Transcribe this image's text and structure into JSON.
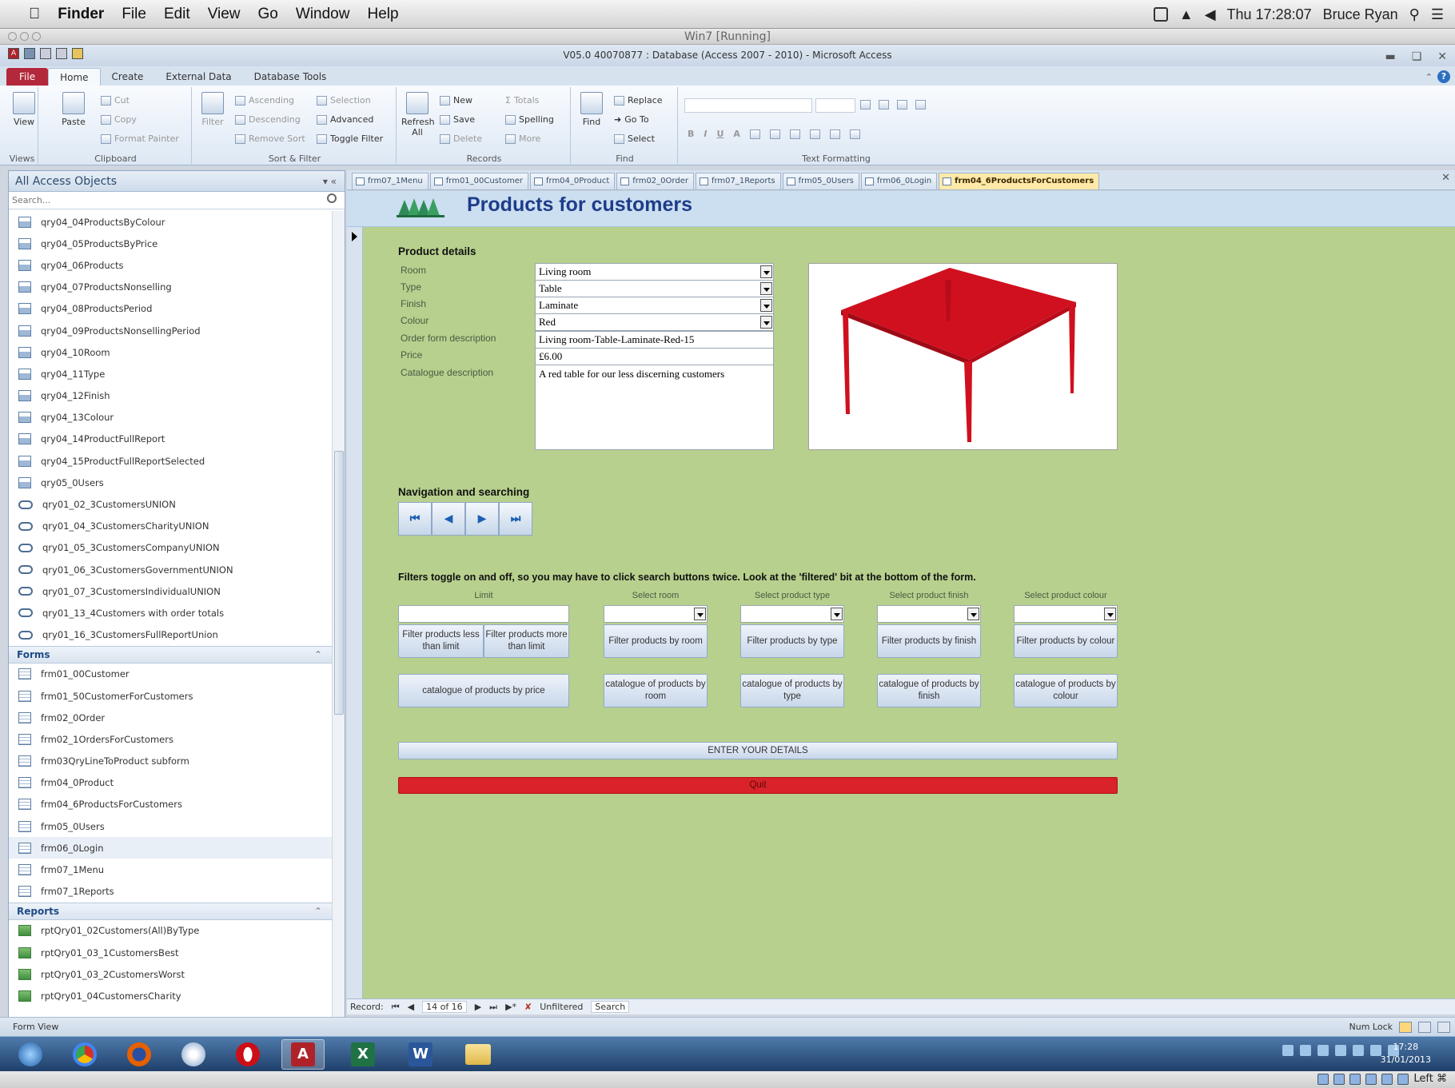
{
  "mac_menubar": {
    "items": [
      "Finder",
      "File",
      "Edit",
      "View",
      "Go",
      "Window",
      "Help"
    ],
    "clock": "Thu 17:28:07",
    "user": "Bruce Ryan"
  },
  "vm_title": "Win7 [Running]",
  "access_title": "V05.0 40070877 : Database (Access 2007 - 2010) - Microsoft Access",
  "ribbon_tabs": [
    "File",
    "Home",
    "Create",
    "External Data",
    "Database Tools"
  ],
  "ribbon": {
    "views": {
      "view": "View",
      "group": "Views"
    },
    "clipboard": {
      "paste": "Paste",
      "cut": "Cut",
      "copy": "Copy",
      "format_painter": "Format Painter",
      "group": "Clipboard"
    },
    "sort_filter": {
      "filter": "Filter",
      "ascending": "Ascending",
      "descending": "Descending",
      "remove_sort": "Remove Sort",
      "selection": "Selection",
      "advanced": "Advanced",
      "toggle_filter": "Toggle Filter",
      "group": "Sort & Filter"
    },
    "records": {
      "refresh": "Refresh All",
      "new": "New",
      "save": "Save",
      "delete": "Delete",
      "totals": "Totals",
      "spelling": "Spelling",
      "more": "More",
      "group": "Records"
    },
    "find": {
      "find": "Find",
      "replace": "Replace",
      "goto": "Go To",
      "select": "Select",
      "group": "Find"
    },
    "text_formatting": {
      "group": "Text Formatting"
    }
  },
  "nav_pane": {
    "title": "All Access Objects",
    "search_placeholder": "Search...",
    "queries": [
      {
        "name": "qry04_04ProductsByColour",
        "icon": "query"
      },
      {
        "name": "qry04_05ProductsByPrice",
        "icon": "query"
      },
      {
        "name": "qry04_06Products",
        "icon": "query"
      },
      {
        "name": "qry04_07ProductsNonselling",
        "icon": "query"
      },
      {
        "name": "qry04_08ProductsPeriod",
        "icon": "query"
      },
      {
        "name": "qry04_09ProductsNonsellingPeriod",
        "icon": "query"
      },
      {
        "name": "qry04_10Room",
        "icon": "query"
      },
      {
        "name": "qry04_11Type",
        "icon": "query"
      },
      {
        "name": "qry04_12Finish",
        "icon": "query"
      },
      {
        "name": "qry04_13Colour",
        "icon": "query"
      },
      {
        "name": "qry04_14ProductFullReport",
        "icon": "query"
      },
      {
        "name": "qry04_15ProductFullReportSelected",
        "icon": "query"
      },
      {
        "name": "qry05_0Users",
        "icon": "query"
      },
      {
        "name": "qry01_02_3CustomersUNION",
        "icon": "union"
      },
      {
        "name": "qry01_04_3CustomersCharityUNION",
        "icon": "union"
      },
      {
        "name": "qry01_05_3CustomersCompanyUNION",
        "icon": "union"
      },
      {
        "name": "qry01_06_3CustomersGovernmentUNION",
        "icon": "union"
      },
      {
        "name": "qry01_07_3CustomersIndividualUNION",
        "icon": "union"
      },
      {
        "name": "qry01_13_4Customers with order totals",
        "icon": "union"
      },
      {
        "name": "qry01_16_3CustomersFullReportUnion",
        "icon": "union"
      }
    ],
    "forms_header": "Forms",
    "forms": [
      "frm01_00Customer",
      "frm01_50CustomerForCustomers",
      "frm02_0Order",
      "frm02_1OrdersForCustomers",
      "frm03QryLineToProduct subform",
      "frm04_0Product",
      "frm04_6ProductsForCustomers",
      "frm05_0Users",
      "frm06_0Login",
      "frm07_1Menu",
      "frm07_1Reports"
    ],
    "reports_header": "Reports",
    "reports": [
      "rptQry01_02Customers(All)ByType",
      "rptQry01_03_1CustomersBest",
      "rptQry01_03_2CustomersWorst",
      "rptQry01_04CustomersCharity"
    ]
  },
  "doc_tabs": [
    "frm07_1Menu",
    "frm01_00Customer",
    "frm04_0Product",
    "frm02_0Order",
    "frm07_1Reports",
    "frm05_0Users",
    "frm06_0Login",
    "frm04_6ProductsForCustomers"
  ],
  "form": {
    "title": "Products for customers",
    "product_details_title": "Product details",
    "fields": [
      {
        "label": "Room",
        "value": "Living room",
        "dropdown": true
      },
      {
        "label": "Type",
        "value": "Table",
        "dropdown": true
      },
      {
        "label": "Finish",
        "value": "Laminate",
        "dropdown": true
      },
      {
        "label": "Colour",
        "value": "Red",
        "dropdown": true
      },
      {
        "label": "Order form description",
        "value": "Living room-Table-Laminate-Red-15",
        "dropdown": false
      },
      {
        "label": "Price",
        "value": "£6.00",
        "dropdown": false
      },
      {
        "label": "Catalogue description",
        "value": "A red table for our less discerning customers",
        "dropdown": false
      }
    ],
    "product_image": "red-table-picture",
    "product_color": "#d0101e",
    "nav_title": "Navigation and searching",
    "filter_note": "Filters toggle on and off, so you may have to click search buttons twice. Look at the 'filtered' bit at the bottom of the form.",
    "filter_labels": [
      "Limit",
      "Select room",
      "Select product type",
      "Select product finish",
      "Select product colour"
    ],
    "filter_buttons": [
      "Filter products less than limit",
      "Filter products more than limit",
      "Filter products by room",
      "Filter products by type",
      "Filter products by finish",
      "Filter products by colour"
    ],
    "catalogue_buttons": [
      "catalogue of products by price",
      "catalogue of products by room",
      "catalogue of products by type",
      "catalogue of products by finish",
      "catalogue of products by colour"
    ],
    "enter_details": "ENTER YOUR DETAILS",
    "quit": "Quit",
    "quit_color": "#d9222a",
    "body_color": "#b7d08d"
  },
  "record_nav": {
    "label": "Record:",
    "position": "14 of 16",
    "filter": "Unfiltered",
    "search": "Search"
  },
  "status": {
    "left": "Form View",
    "right": "Num Lock"
  },
  "taskbar_clock": {
    "time": "17:28",
    "date": "31/01/2013"
  },
  "mac_bottom": "Left ⌘"
}
